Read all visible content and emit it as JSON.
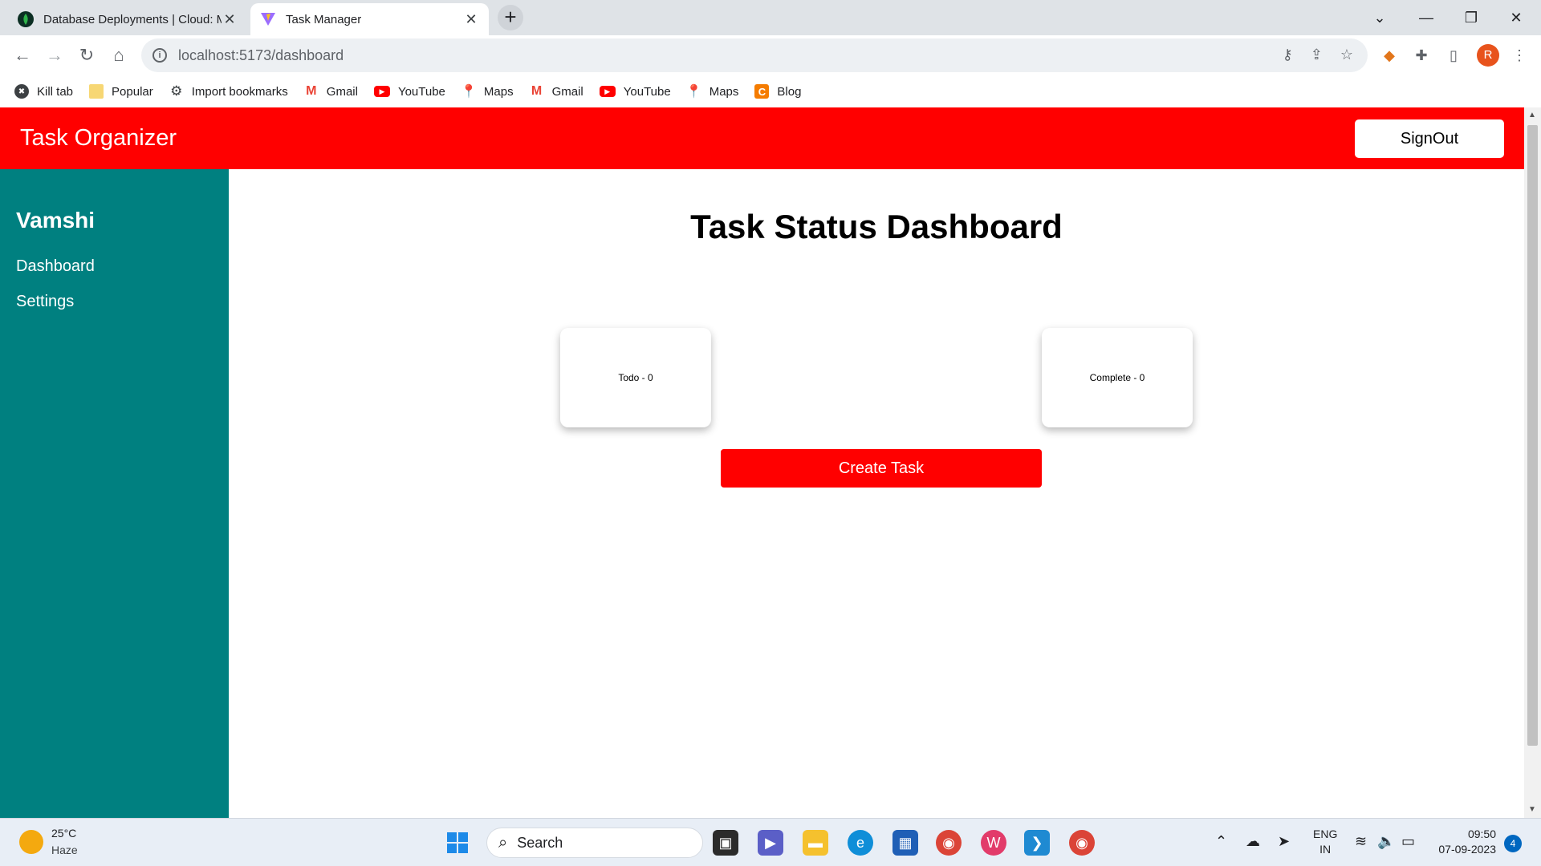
{
  "browser": {
    "tabs": [
      {
        "title": "Database Deployments | Cloud: M",
        "active": false,
        "favicon": "mongodb-leaf-icon"
      },
      {
        "title": "Task Manager",
        "active": true,
        "favicon": "vite-logo-icon"
      }
    ],
    "url": "localhost:5173/dashboard",
    "profile_initial": "R",
    "bookmarks": [
      {
        "label": "Kill tab",
        "icon": "kill-tab-icon"
      },
      {
        "label": "Popular",
        "icon": "folder-icon"
      },
      {
        "label": "Import bookmarks",
        "icon": "gear-icon"
      },
      {
        "label": "Gmail",
        "icon": "gmail-icon"
      },
      {
        "label": "YouTube",
        "icon": "youtube-icon"
      },
      {
        "label": "Maps",
        "icon": "maps-icon"
      },
      {
        "label": "Gmail",
        "icon": "gmail-icon"
      },
      {
        "label": "YouTube",
        "icon": "youtube-icon"
      },
      {
        "label": "Maps",
        "icon": "maps-icon"
      },
      {
        "label": "Blog",
        "icon": "blog-icon"
      }
    ]
  },
  "app": {
    "title": "Task Organizer",
    "signout_label": "SignOut",
    "colors": {
      "header": "#ff0000",
      "sidebar": "#008080",
      "button": "#ff0000"
    },
    "sidebar": {
      "user_name": "Vamshi",
      "items": [
        {
          "label": "Dashboard"
        },
        {
          "label": "Settings"
        }
      ]
    },
    "main": {
      "title": "Task Status Dashboard",
      "cards": [
        {
          "label": "Todo - 0"
        },
        {
          "label": "Complete - 0"
        }
      ],
      "create_label": "Create Task"
    }
  },
  "taskbar": {
    "weather": {
      "temp": "25°C",
      "desc": "Haze"
    },
    "search_label": "Search",
    "language": {
      "line1": "ENG",
      "line2": "IN"
    },
    "time": "09:50",
    "date": "07-09-2023",
    "notification_count": "4"
  }
}
